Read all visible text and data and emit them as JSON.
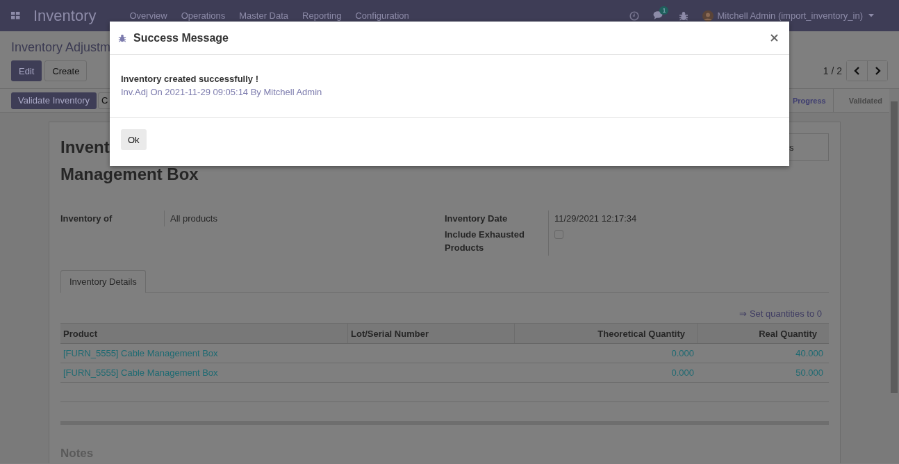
{
  "navbar": {
    "app_name": "Inventory",
    "menu": [
      "Overview",
      "Operations",
      "Master Data",
      "Reporting",
      "Configuration"
    ],
    "chat_badge": "1",
    "user": "Mitchell Admin (import_inventory_in)"
  },
  "control_panel": {
    "breadcrumb": "Inventory Adjustm",
    "buttons": [
      {
        "label": "Edit",
        "kind": "primary"
      },
      {
        "label": "Create",
        "kind": "secondary"
      }
    ],
    "pager": "1 / 2"
  },
  "statusbar": {
    "buttons": [
      {
        "label": "Validate Inventory",
        "kind": "primary"
      },
      {
        "label": "C",
        "kind": "secondary"
      }
    ],
    "stages": [
      {
        "label": "Progress",
        "selected": true
      },
      {
        "label": "Validated",
        "selected": false
      }
    ]
  },
  "sheet": {
    "smart_button": "s",
    "title_lines": [
      "Invent",
      "Management Box"
    ],
    "fields_left": [
      {
        "label": "Inventory of",
        "kind": "text",
        "value": "All products"
      }
    ],
    "fields_right": [
      {
        "label": "Inventory Date",
        "kind": "text",
        "value": "11/29/2021 12:17:34"
      },
      {
        "label": "Include Exhausted Products",
        "kind": "checkbox",
        "checked": false
      }
    ],
    "tabs": [
      {
        "label": "Inventory Details",
        "selected": true
      }
    ],
    "action_link": "⇒ Set quantities to 0",
    "table": {
      "columns": [
        "Product",
        "Lot/Serial Number",
        "Theoretical Quantity",
        "Real Quantity"
      ],
      "rows": [
        {
          "product": "[FURN_5555] Cable Management Box",
          "lot": "",
          "theoretical": "0.000",
          "real": "40.000"
        },
        {
          "product": "[FURN_5555] Cable Management Box",
          "lot": "",
          "theoretical": "0.000",
          "real": "50.000"
        }
      ]
    },
    "notes_heading": "Notes"
  },
  "dialog": {
    "title": "Success Message",
    "heading": "Inventory created successfully !",
    "message": "Inv.Adj On 2021-11-29 09:05:14 By Mitchell Admin",
    "buttons": [
      "Ok"
    ]
  }
}
